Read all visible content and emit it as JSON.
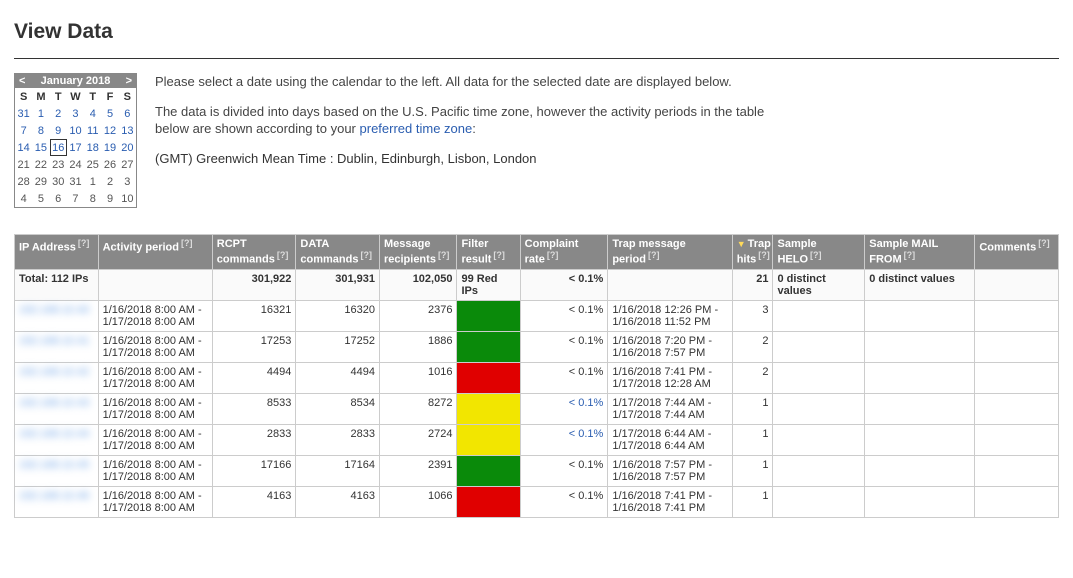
{
  "title": "View Data",
  "calendar": {
    "prev": "<",
    "next": ">",
    "month_label": "January 2018",
    "dow": [
      "S",
      "M",
      "T",
      "W",
      "T",
      "F",
      "S"
    ],
    "weeks": [
      [
        {
          "d": "31",
          "link": true
        },
        {
          "d": "1",
          "link": true
        },
        {
          "d": "2",
          "link": true
        },
        {
          "d": "3",
          "link": true
        },
        {
          "d": "4",
          "link": true
        },
        {
          "d": "5",
          "link": true
        },
        {
          "d": "6",
          "link": true
        }
      ],
      [
        {
          "d": "7",
          "link": true
        },
        {
          "d": "8",
          "link": true
        },
        {
          "d": "9",
          "link": true
        },
        {
          "d": "10",
          "link": true
        },
        {
          "d": "11",
          "link": true
        },
        {
          "d": "12",
          "link": true
        },
        {
          "d": "13",
          "link": true
        }
      ],
      [
        {
          "d": "14",
          "link": true
        },
        {
          "d": "15",
          "link": true
        },
        {
          "d": "16",
          "link": true,
          "sel": true
        },
        {
          "d": "17",
          "link": true
        },
        {
          "d": "18",
          "link": true
        },
        {
          "d": "19",
          "link": true
        },
        {
          "d": "20",
          "link": true
        }
      ],
      [
        {
          "d": "21"
        },
        {
          "d": "22"
        },
        {
          "d": "23"
        },
        {
          "d": "24"
        },
        {
          "d": "25"
        },
        {
          "d": "26"
        },
        {
          "d": "27"
        }
      ],
      [
        {
          "d": "28"
        },
        {
          "d": "29"
        },
        {
          "d": "30"
        },
        {
          "d": "31"
        },
        {
          "d": "1"
        },
        {
          "d": "2"
        },
        {
          "d": "3"
        }
      ],
      [
        {
          "d": "4"
        },
        {
          "d": "5"
        },
        {
          "d": "6"
        },
        {
          "d": "7"
        },
        {
          "d": "8"
        },
        {
          "d": "9"
        },
        {
          "d": "10"
        }
      ]
    ]
  },
  "intro": {
    "p1": "Please select a date using the calendar to the left. All data for the selected date are displayed below.",
    "p2a": "The data is divided into days based on the U.S. Pacific time zone, however the activity periods in the table below are shown according to your ",
    "p2_link": "preferred time zone",
    "p2b": ":",
    "tz": "(GMT) Greenwich Mean Time : Dublin, Edinburgh, Lisbon, London"
  },
  "columns": {
    "ip": "IP Address",
    "activity": "Activity period",
    "rcpt": "RCPT commands",
    "data": "DATA commands",
    "msg": "Message recipients",
    "filter": "Filter result",
    "complaint": "Complaint rate",
    "trap_period": "Trap message period",
    "trap_hits": "Trap hits",
    "helo": "Sample HELO",
    "mailfrom": "Sample MAIL FROM",
    "comments": "Comments",
    "help": "[?]",
    "sort_arrow": "▼"
  },
  "total": {
    "label": "Total: 112 IPs",
    "rcpt": "301,922",
    "data": "301,931",
    "msg": "102,050",
    "filter": "99 Red IPs",
    "complaint": "< 0.1%",
    "trap_hits": "21",
    "helo": "0 distinct values",
    "mailfrom": "0 distinct values"
  },
  "rows": [
    {
      "ip": "192.168.10.40",
      "activity": "1/16/2018 8:00 AM - 1/17/2018 8:00 AM",
      "rcpt": "16321",
      "data": "16320",
      "msg": "2376",
      "filter": "green",
      "complaint": "< 0.1%",
      "trap_period": "1/16/2018 12:26 PM - 1/16/2018 11:52 PM",
      "trap_hits": "3"
    },
    {
      "ip": "192.168.10.41",
      "activity": "1/16/2018 8:00 AM - 1/17/2018 8:00 AM",
      "rcpt": "17253",
      "data": "17252",
      "msg": "1886",
      "filter": "green",
      "complaint": "< 0.1%",
      "trap_period": "1/16/2018 7:20 PM - 1/16/2018 7:57 PM",
      "trap_hits": "2"
    },
    {
      "ip": "192.168.10.42",
      "activity": "1/16/2018 8:00 AM - 1/17/2018 8:00 AM",
      "rcpt": "4494",
      "data": "4494",
      "msg": "1016",
      "filter": "red",
      "complaint": "< 0.1%",
      "trap_period": "1/16/2018 7:41 PM - 1/17/2018 12:28 AM",
      "trap_hits": "2"
    },
    {
      "ip": "192.168.10.43",
      "activity": "1/16/2018 8:00 AM - 1/17/2018 8:00 AM",
      "rcpt": "8533",
      "data": "8534",
      "msg": "8272",
      "filter": "yellow",
      "complaint": "< 0.1%",
      "complaint_link": true,
      "trap_period": "1/17/2018 7:44 AM - 1/17/2018 7:44 AM",
      "trap_hits": "1"
    },
    {
      "ip": "192.168.10.44",
      "activity": "1/16/2018 8:00 AM - 1/17/2018 8:00 AM",
      "rcpt": "2833",
      "data": "2833",
      "msg": "2724",
      "filter": "yellow",
      "complaint": "< 0.1%",
      "complaint_link": true,
      "trap_period": "1/17/2018 6:44 AM - 1/17/2018 6:44 AM",
      "trap_hits": "1"
    },
    {
      "ip": "192.168.10.45",
      "activity": "1/16/2018 8:00 AM - 1/17/2018 8:00 AM",
      "rcpt": "17166",
      "data": "17164",
      "msg": "2391",
      "filter": "green",
      "complaint": "< 0.1%",
      "trap_period": "1/16/2018 7:57 PM - 1/16/2018 7:57 PM",
      "trap_hits": "1"
    },
    {
      "ip": "192.168.10.46",
      "activity": "1/16/2018 8:00 AM - 1/17/2018 8:00 AM",
      "rcpt": "4163",
      "data": "4163",
      "msg": "1066",
      "filter": "red",
      "complaint": "< 0.1%",
      "trap_period": "1/16/2018 7:41 PM - 1/16/2018 7:41 PM",
      "trap_hits": "1"
    }
  ]
}
